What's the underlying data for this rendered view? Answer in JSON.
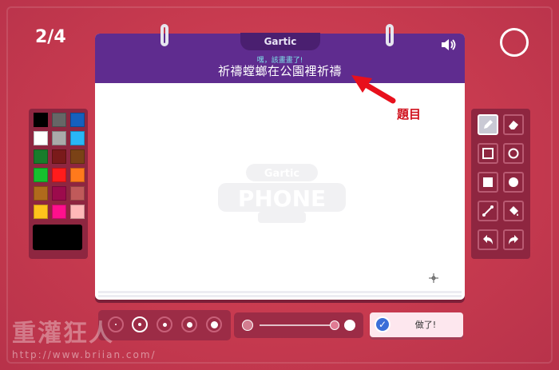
{
  "round": {
    "counter": "2/4"
  },
  "board": {
    "logo": "Gartic",
    "subtitle": "嘿，該畫畫了!",
    "prompt": "祈禱螳螂在公園裡祈禱",
    "watermark_text": "Gartic PHONE"
  },
  "annotation": {
    "label": "題目",
    "color": "#d0101c"
  },
  "palette": {
    "colors": [
      "#000000",
      "#666666",
      "#1560bd",
      "#ffffff",
      "#aaaaaa",
      "#29b6f6",
      "#197c2b",
      "#7a1a1a",
      "#7a4216",
      "#16c02e",
      "#ff1c1c",
      "#ff7a1c",
      "#b06a1c",
      "#9c0b4c",
      "#c05a5a",
      "#ffc21c",
      "#ff108c",
      "#ffb8b8"
    ],
    "current": "#000000"
  },
  "tools": [
    "pencil-icon",
    "eraser-icon",
    "square-outline-icon",
    "circle-outline-icon",
    "square-fill-icon",
    "circle-fill-icon",
    "line-icon",
    "fill-bucket-icon",
    "undo-icon",
    "redo-icon"
  ],
  "brush": {
    "sizes": 5,
    "selected_index": 1
  },
  "done_button": {
    "label": "做了!"
  },
  "site": {
    "watermark": "重灌狂人",
    "url": "http://www.briian.com/"
  },
  "colors": {
    "background": "#c73a4f",
    "board_header": "#5f2c8f",
    "panel": "#8e2640"
  }
}
